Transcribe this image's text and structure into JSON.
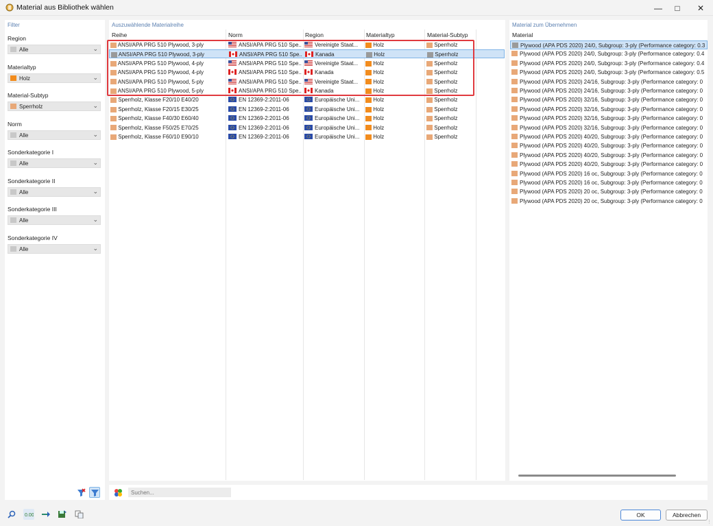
{
  "window": {
    "title": "Material aus Bibliothek wählen"
  },
  "filter": {
    "heading": "Filter",
    "items": [
      {
        "label": "Region",
        "value": "Alle",
        "color": "#c8c8c8"
      },
      {
        "label": "Materialtyp",
        "value": "Holz",
        "color": "#f28c1e"
      },
      {
        "label": "Material-Subtyp",
        "value": "Sperrholz",
        "color": "#e8a878"
      },
      {
        "label": "Norm",
        "value": "Alle",
        "color": "#c8c8c8"
      },
      {
        "label": "Sonderkategorie I",
        "value": "Alle",
        "color": "#c8c8c8"
      },
      {
        "label": "Sonderkategorie II",
        "value": "Alle",
        "color": "#c8c8c8"
      },
      {
        "label": "Sonderkategorie III",
        "value": "Alle",
        "color": "#c8c8c8"
      },
      {
        "label": "Sonderkategorie IV",
        "value": "Alle",
        "color": "#c8c8c8"
      }
    ]
  },
  "series": {
    "heading": "Auszuwählende Materialreihe",
    "columns": [
      "Reihe",
      "Norm",
      "Region",
      "Materialtyp",
      "Material-Subtyp"
    ],
    "rows": [
      {
        "name": "ANSI/APA PRG 510 Plywood, 3-ply",
        "norm": "ANSI/APA PRG 510 Spe...",
        "flag": "us",
        "region": "Vereinigte Staat...",
        "type": "Holz",
        "subtype": "Sperrholz",
        "selected": false
      },
      {
        "name": "ANSI/APA PRG 510 Plywood, 3-ply",
        "norm": "ANSI/APA PRG 510 Spe...",
        "flag": "ca",
        "region": "Kanada",
        "type": "Holz",
        "subtype": "Sperrholz",
        "selected": true
      },
      {
        "name": "ANSI/APA PRG 510 Plywood, 4-ply",
        "norm": "ANSI/APA PRG 510 Spe...",
        "flag": "us",
        "region": "Vereinigte Staat...",
        "type": "Holz",
        "subtype": "Sperrholz",
        "selected": false
      },
      {
        "name": "ANSI/APA PRG 510 Plywood, 4-ply",
        "norm": "ANSI/APA PRG 510 Spe...",
        "flag": "ca",
        "region": "Kanada",
        "type": "Holz",
        "subtype": "Sperrholz",
        "selected": false
      },
      {
        "name": "ANSI/APA PRG 510 Plywood, 5-ply",
        "norm": "ANSI/APA PRG 510 Spe...",
        "flag": "us",
        "region": "Vereinigte Staat...",
        "type": "Holz",
        "subtype": "Sperrholz",
        "selected": false
      },
      {
        "name": "ANSI/APA PRG 510 Plywood, 5-ply",
        "norm": "ANSI/APA PRG 510 Spe...",
        "flag": "ca",
        "region": "Kanada",
        "type": "Holz",
        "subtype": "Sperrholz",
        "selected": false
      },
      {
        "name": "Sperrholz, Klasse F20/10 E40/20",
        "norm": "EN 12369-2:2011-06",
        "flag": "eu",
        "region": "Europäische Uni...",
        "type": "Holz",
        "subtype": "Sperrholz",
        "selected": false
      },
      {
        "name": "Sperrholz, Klasse F20/15 E30/25",
        "norm": "EN 12369-2:2011-06",
        "flag": "eu",
        "region": "Europäische Uni...",
        "type": "Holz",
        "subtype": "Sperrholz",
        "selected": false
      },
      {
        "name": "Sperrholz, Klasse F40/30 E60/40",
        "norm": "EN 12369-2:2011-06",
        "flag": "eu",
        "region": "Europäische Uni...",
        "type": "Holz",
        "subtype": "Sperrholz",
        "selected": false
      },
      {
        "name": "Sperrholz, Klasse F50/25 E70/25",
        "norm": "EN 12369-2:2011-06",
        "flag": "eu",
        "region": "Europäische Uni...",
        "type": "Holz",
        "subtype": "Sperrholz",
        "selected": false
      },
      {
        "name": "Sperrholz, Klasse F60/10 E90/10",
        "norm": "EN 12369-2:2011-06",
        "flag": "eu",
        "region": "Europäische Uni...",
        "type": "Holz",
        "subtype": "Sperrholz",
        "selected": false
      }
    ]
  },
  "materials": {
    "heading": "Material zum Übernehmen",
    "column": "Material",
    "rows": [
      "Plywood (APA PDS 2020) 24/0, Subgroup: 3-ply (Performance category: 0.3",
      "Plywood (APA PDS 2020) 24/0, Subgroup: 3-ply (Performance category: 0.4",
      "Plywood (APA PDS 2020) 24/0, Subgroup: 3-ply (Performance category: 0.4",
      "Plywood (APA PDS 2020) 24/0, Subgroup: 3-ply (Performance category: 0.5",
      "Plywood (APA PDS 2020) 24/16, Subgroup: 3-ply (Performance category: 0",
      "Plywood (APA PDS 2020) 24/16, Subgroup: 3-ply (Performance category: 0",
      "Plywood (APA PDS 2020) 32/16, Subgroup: 3-ply (Performance category: 0",
      "Plywood (APA PDS 2020) 32/16, Subgroup: 3-ply (Performance category: 0",
      "Plywood (APA PDS 2020) 32/16, Subgroup: 3-ply (Performance category: 0",
      "Plywood (APA PDS 2020) 32/16, Subgroup: 3-ply (Performance category: 0",
      "Plywood (APA PDS 2020) 40/20, Subgroup: 3-ply (Performance category: 0",
      "Plywood (APA PDS 2020) 40/20, Subgroup: 3-ply (Performance category: 0",
      "Plywood (APA PDS 2020) 40/20, Subgroup: 3-ply (Performance category: 0",
      "Plywood (APA PDS 2020) 40/20, Subgroup: 3-ply (Performance category: 0",
      "Plywood (APA PDS 2020) 16 oc, Subgroup: 3-ply (Performance category: 0",
      "Plywood (APA PDS 2020) 16 oc, Subgroup: 3-ply (Performance category: 0",
      "Plywood (APA PDS 2020) 20 oc, Subgroup: 3-ply (Performance category: 0",
      "Plywood (APA PDS 2020) 20 oc, Subgroup: 3-ply (Performance category: 0"
    ]
  },
  "search": {
    "placeholder": "Suchen..."
  },
  "buttons": {
    "ok": "OK",
    "cancel": "Abbrechen"
  },
  "colors": {
    "holz": "#f28c1e",
    "sperrholz": "#e8a878",
    "grey": "#9a9a9a",
    "highlight": "#e0393e",
    "heading": "#5a7fb0"
  }
}
